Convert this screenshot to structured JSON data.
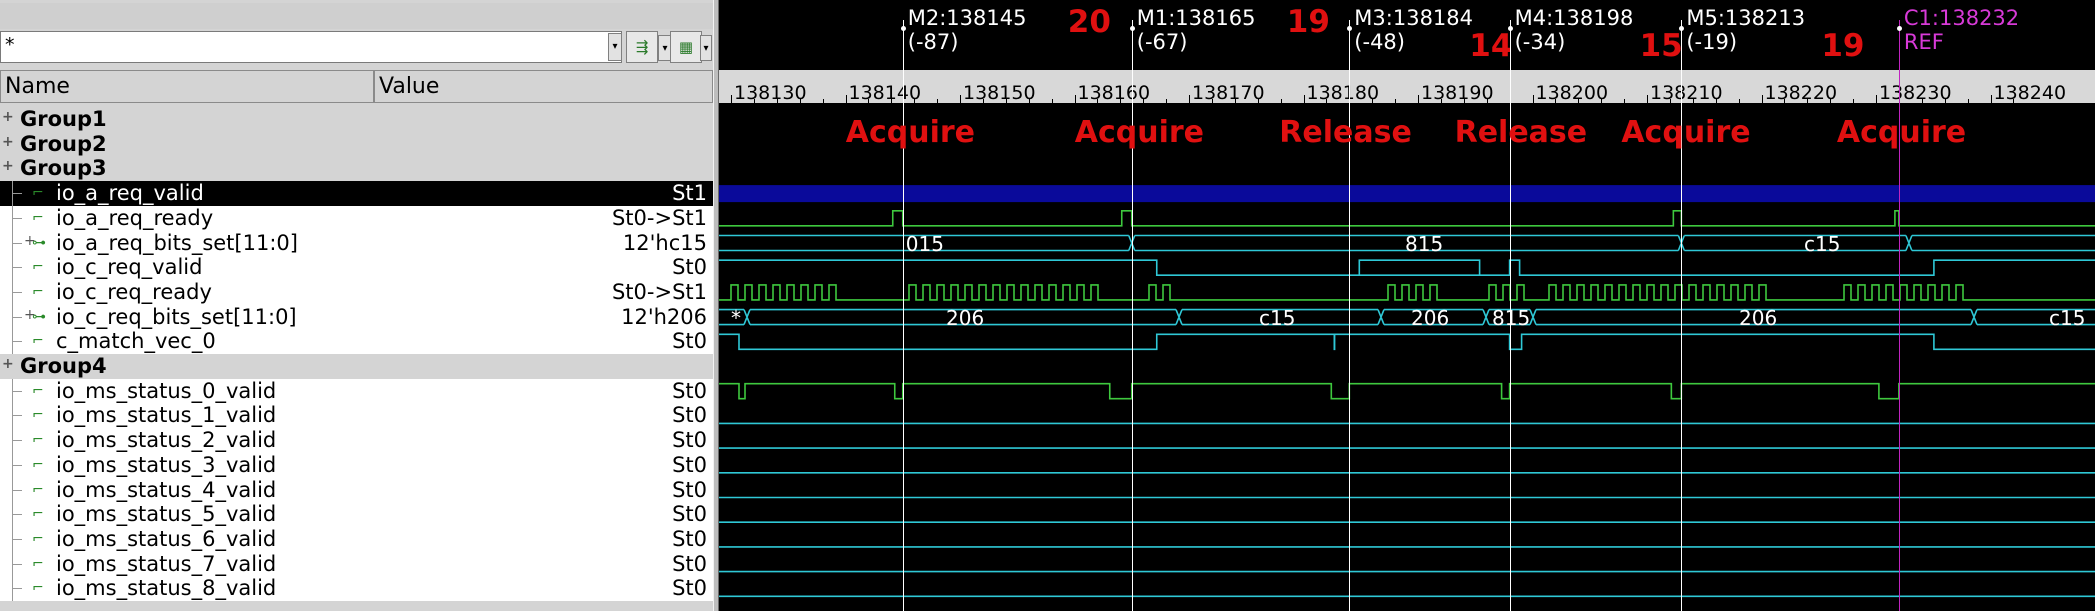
{
  "filter": {
    "value": "*"
  },
  "columns": {
    "name": "Name",
    "value": "Value"
  },
  "rows": [
    {
      "kind": "group",
      "label": "Group1",
      "value": ""
    },
    {
      "kind": "group",
      "label": "Group2",
      "value": ""
    },
    {
      "kind": "group",
      "label": "Group3",
      "value": ""
    },
    {
      "kind": "signal",
      "label": "io_a_req_valid",
      "value": "St1",
      "selected": true
    },
    {
      "kind": "signal",
      "label": "io_a_req_ready",
      "value": "St0->St1"
    },
    {
      "kind": "signal",
      "label": "io_a_req_bits_set[11:0]",
      "value": "12'hc15",
      "bus": true
    },
    {
      "kind": "signal",
      "label": "io_c_req_valid",
      "value": "St0"
    },
    {
      "kind": "signal",
      "label": "io_c_req_ready",
      "value": "St0->St1"
    },
    {
      "kind": "signal",
      "label": "io_c_req_bits_set[11:0]",
      "value": "12'h206",
      "bus": true
    },
    {
      "kind": "signal",
      "label": "c_match_vec_0",
      "value": "St0"
    },
    {
      "kind": "group",
      "label": "Group4",
      "value": ""
    },
    {
      "kind": "signal",
      "label": "io_ms_status_0_valid",
      "value": "St0"
    },
    {
      "kind": "signal",
      "label": "io_ms_status_1_valid",
      "value": "St0"
    },
    {
      "kind": "signal",
      "label": "io_ms_status_2_valid",
      "value": "St0"
    },
    {
      "kind": "signal",
      "label": "io_ms_status_3_valid",
      "value": "St0"
    },
    {
      "kind": "signal",
      "label": "io_ms_status_4_valid",
      "value": "St0"
    },
    {
      "kind": "signal",
      "label": "io_ms_status_5_valid",
      "value": "St0"
    },
    {
      "kind": "signal",
      "label": "io_ms_status_6_valid",
      "value": "St0"
    },
    {
      "kind": "signal",
      "label": "io_ms_status_7_valid",
      "value": "St0"
    },
    {
      "kind": "signal",
      "label": "io_ms_status_8_valid",
      "value": "St0"
    }
  ],
  "time_axis": {
    "ticks": [
      "138130",
      "138140",
      "138150",
      "138160",
      "138170",
      "138180",
      "138190",
      "138200",
      "138210",
      "138220",
      "138230",
      "138240"
    ]
  },
  "markers": [
    {
      "name": "M2",
      "time": "138145",
      "delta": "(-87)",
      "count": "20",
      "annotation": "Acquire"
    },
    {
      "name": "M1",
      "time": "138165",
      "delta": "(-67)",
      "count": "19",
      "annotation": "Acquire"
    },
    {
      "name": "M3",
      "time": "138184",
      "delta": "(-48)",
      "count": "14",
      "annotation": "Release"
    },
    {
      "name": "M4",
      "time": "138198",
      "delta": "(-34)",
      "count": "15",
      "annotation": "Release"
    },
    {
      "name": "M5",
      "time": "138213",
      "delta": "(-19)",
      "count": "19",
      "annotation": "Acquire"
    }
  ],
  "cursor": {
    "name": "C1",
    "time": "138232",
    "ref": "REF",
    "annotation": "Acquire"
  },
  "bus_values": {
    "a_req_bits": [
      "015",
      "815",
      "c15"
    ],
    "c_req_bits": [
      "*",
      "206",
      "c15",
      "206",
      "815",
      "206",
      "c15"
    ]
  },
  "colors": {
    "signal_wave": "#2fc8d6",
    "edge_wave": "#3ec83e",
    "selected_bar": "#0a0a9a",
    "annotation": "#e01010",
    "cursor": "#d83ad8"
  }
}
